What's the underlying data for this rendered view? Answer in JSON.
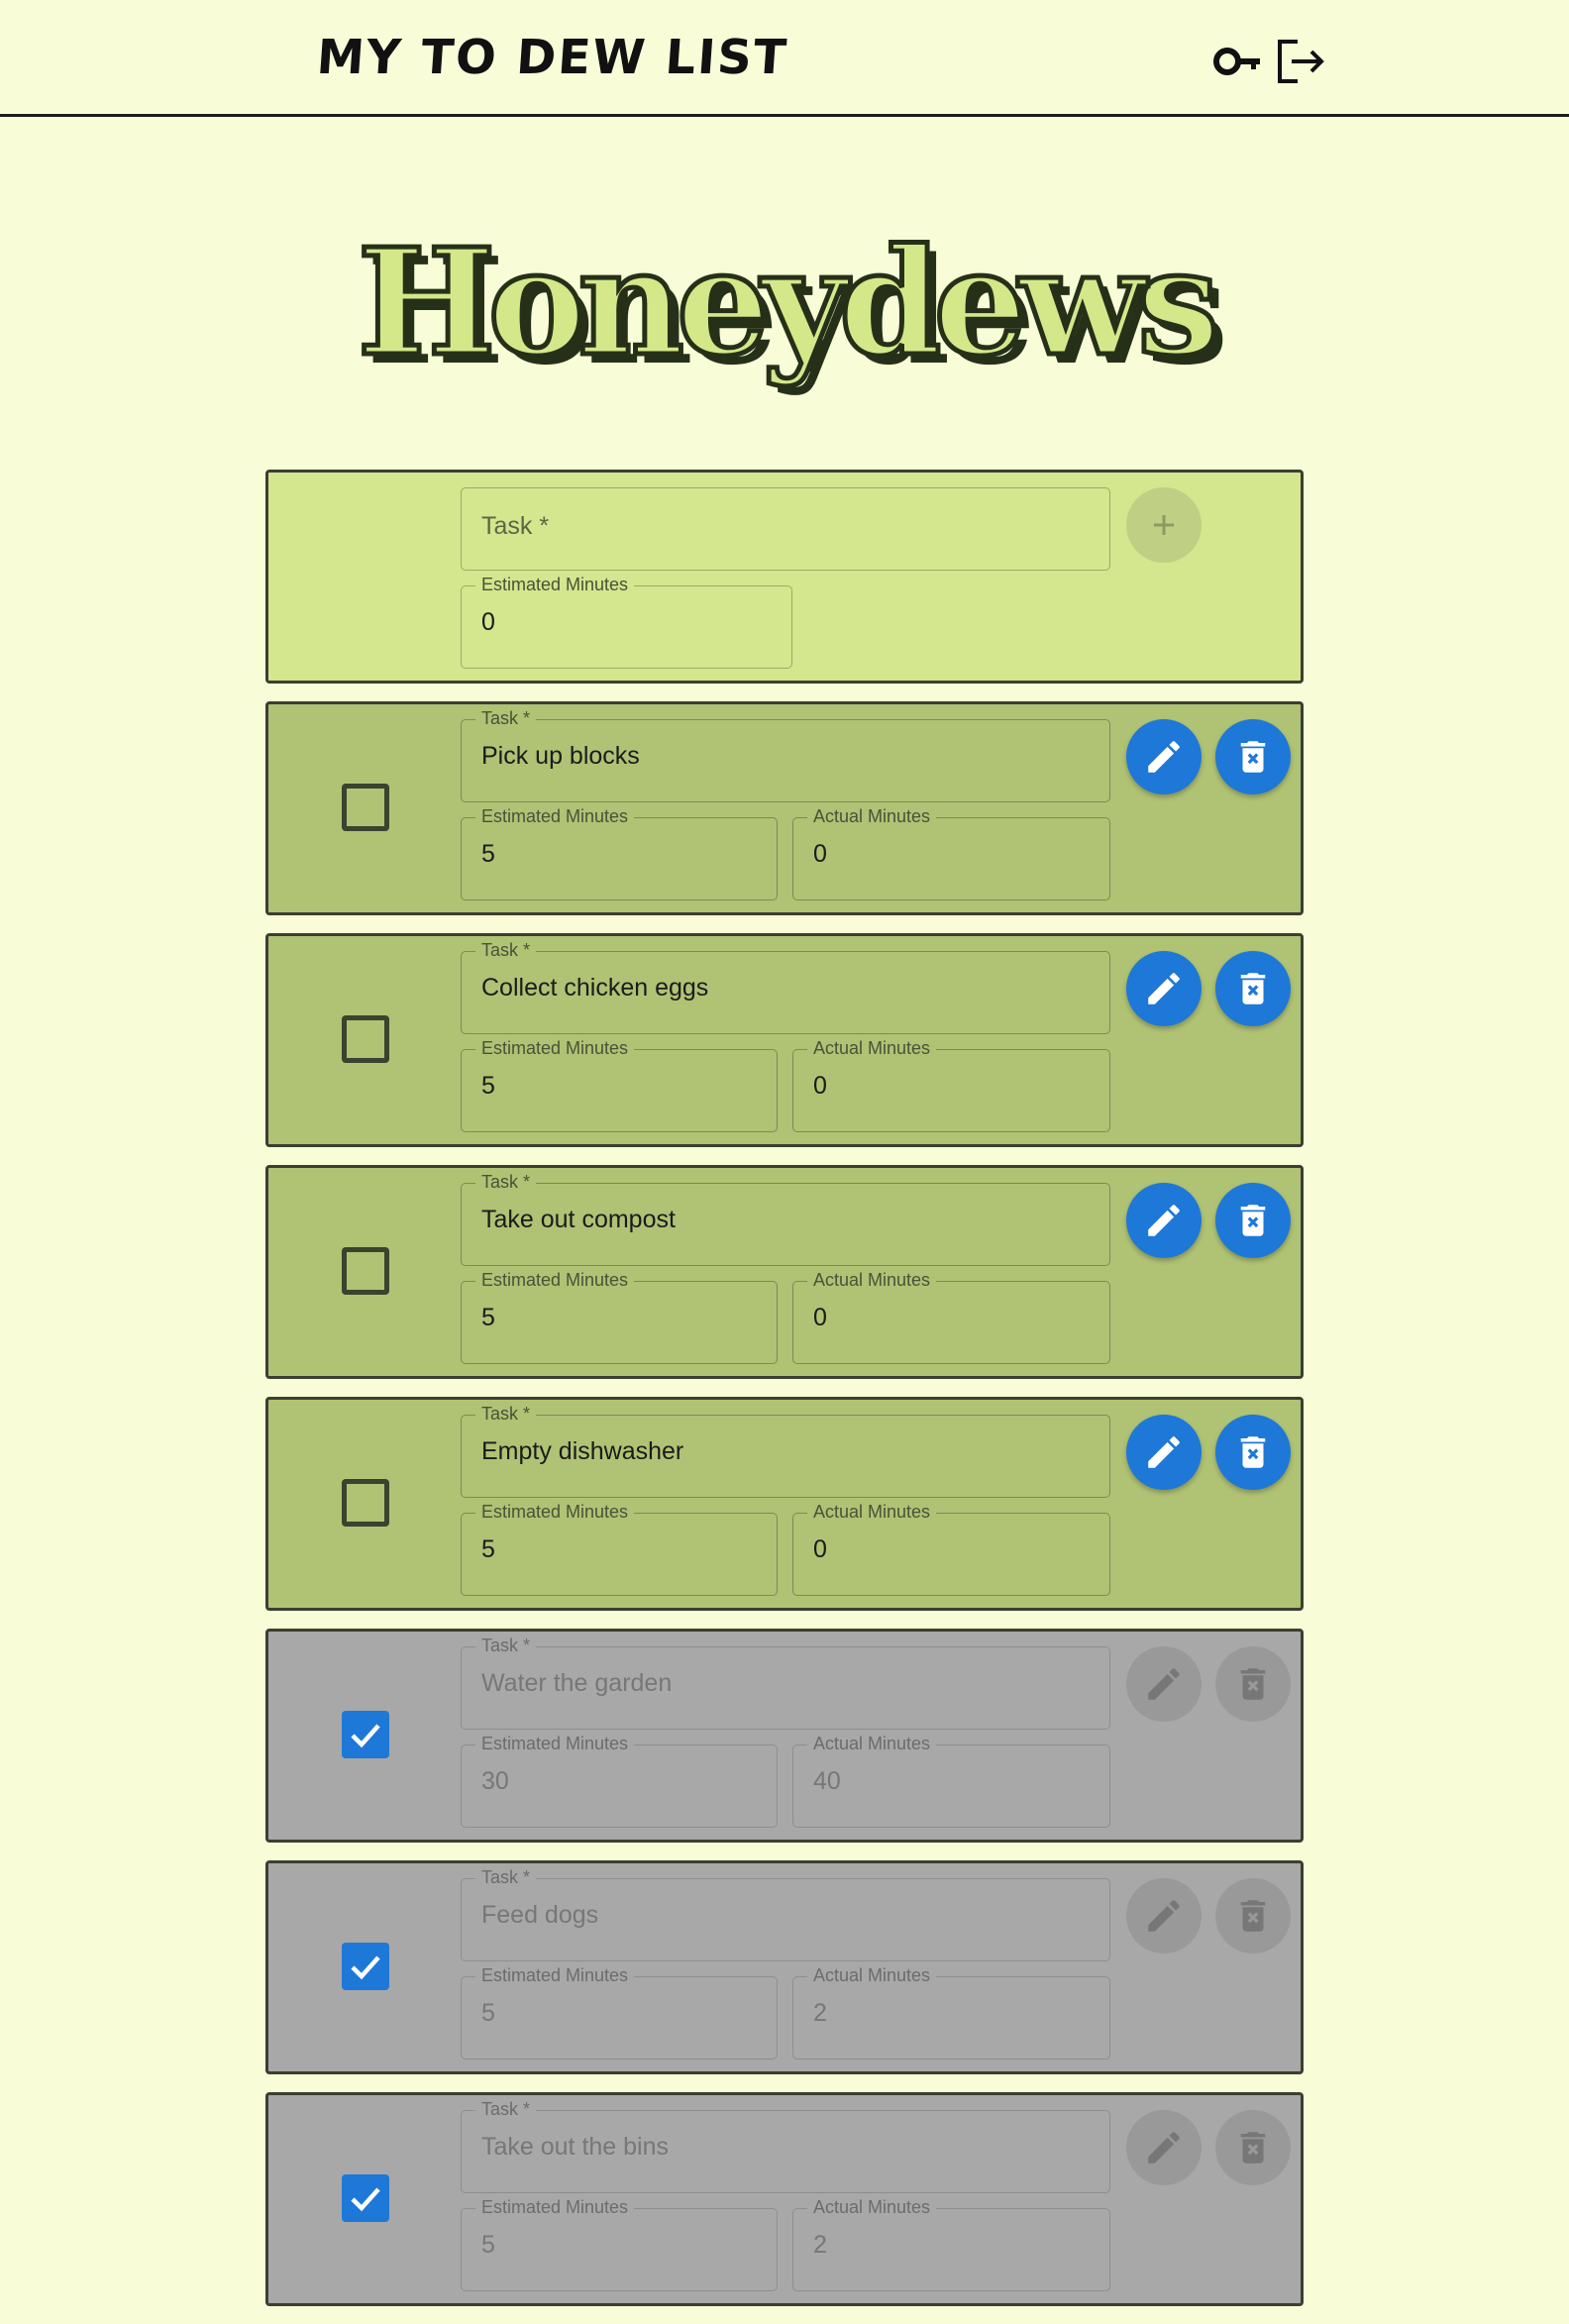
{
  "header": {
    "title": "MY TO DEW LIST",
    "key_icon": "key-icon",
    "logout_icon": "logout-icon"
  },
  "hero": {
    "title": "Honeydews"
  },
  "new_task": {
    "task_placeholder": "Task *",
    "estimated_label": "Estimated Minutes",
    "estimated_value": "0",
    "add_icon": "plus-icon"
  },
  "labels": {
    "task": "Task *",
    "estimated": "Estimated Minutes",
    "actual": "Actual Minutes"
  },
  "tasks": [
    {
      "task": "Pick up blocks",
      "estimated": "5",
      "actual": "0",
      "done": false
    },
    {
      "task": "Collect chicken eggs",
      "estimated": "5",
      "actual": "0",
      "done": false
    },
    {
      "task": "Take out compost",
      "estimated": "5",
      "actual": "0",
      "done": false
    },
    {
      "task": "Empty dishwasher",
      "estimated": "5",
      "actual": "0",
      "done": false
    },
    {
      "task": "Water the garden",
      "estimated": "30",
      "actual": "40",
      "done": true
    },
    {
      "task": "Feed dogs",
      "estimated": "5",
      "actual": "2",
      "done": true
    },
    {
      "task": "Take out the bins",
      "estimated": "5",
      "actual": "2",
      "done": true
    }
  ],
  "colors": {
    "background": "#f8fdd8",
    "new_card": "#d4e68e",
    "open_card": "#b0c274",
    "done_card": "#a8a8a8",
    "accent": "#1e78d8"
  }
}
